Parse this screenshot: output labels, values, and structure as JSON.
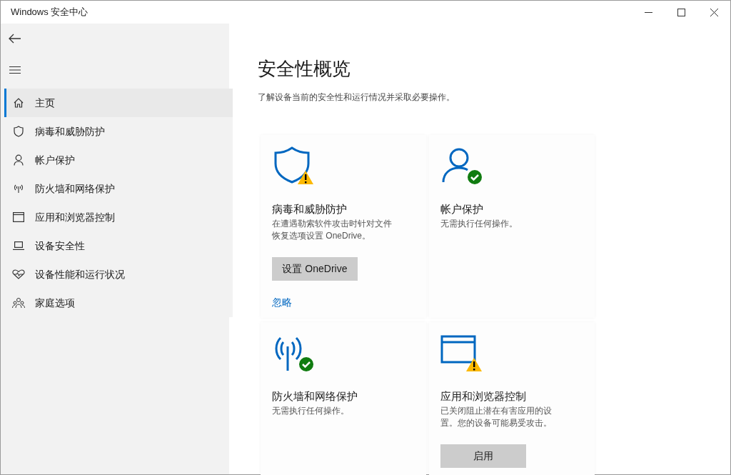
{
  "window": {
    "title": "Windows 安全中心"
  },
  "sidebar": {
    "items": [
      {
        "kind": "home",
        "label": "主页",
        "selected": true
      },
      {
        "kind": "shield",
        "label": "病毒和威胁防护",
        "selected": false
      },
      {
        "kind": "person",
        "label": "帐户保护",
        "selected": false
      },
      {
        "kind": "antenna",
        "label": "防火墙和网络保护",
        "selected": false
      },
      {
        "kind": "window",
        "label": "应用和浏览器控制",
        "selected": false
      },
      {
        "kind": "laptop",
        "label": "设备安全性",
        "selected": false
      },
      {
        "kind": "heart",
        "label": "设备性能和运行状况",
        "selected": false
      },
      {
        "kind": "family",
        "label": "家庭选项",
        "selected": false
      }
    ]
  },
  "main": {
    "title": "安全性概览",
    "subtitle": "了解设备当前的安全性和运行情况并采取必要操作。",
    "cards": [
      {
        "kind": "shield",
        "warning": true,
        "title": "病毒和威胁防护",
        "description": "在遭遇勒索软件攻击时针对文件恢复选项设置 OneDrive。",
        "button": "设置 OneDrive",
        "link": "忽略"
      },
      {
        "kind": "person",
        "warning": false,
        "title": "帐户保护",
        "description": "无需执行任何操作。"
      },
      {
        "kind": "antenna",
        "warning": false,
        "title": "防火墙和网络保护",
        "description": "无需执行任何操作。"
      },
      {
        "kind": "window",
        "warning": true,
        "title": "应用和浏览器控制",
        "description": "已关闭阻止潜在有害应用的设置。您的设备可能易受攻击。",
        "button": "启用"
      }
    ]
  }
}
